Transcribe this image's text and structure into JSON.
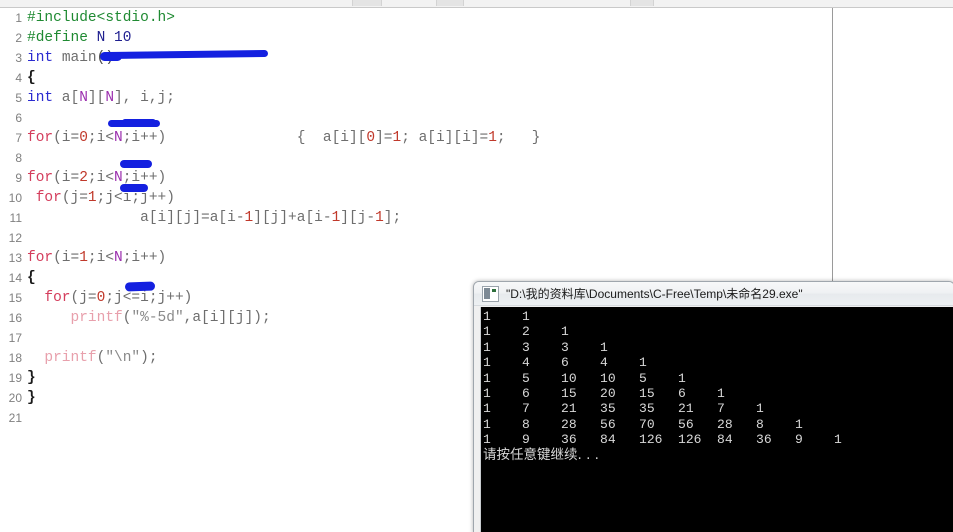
{
  "window": {
    "app_kind": "c-ide-editor"
  },
  "editor": {
    "name": "code-editor",
    "language": "c",
    "first_line_number": 1,
    "lines": [
      {
        "n": "1",
        "tokens": [
          {
            "t": "#include<stdio.h>",
            "c": "tok-pre"
          }
        ]
      },
      {
        "n": "2",
        "tokens": [
          {
            "t": "#define ",
            "c": "tok-pre"
          },
          {
            "t": "N",
            "c": "tok-macro-dark"
          },
          {
            "t": " 10",
            "c": "tok-macro-dark"
          }
        ]
      },
      {
        "n": "3",
        "tokens": [
          {
            "t": "int",
            "c": "tok-kw"
          },
          {
            "t": " ",
            "c": "tok-punc"
          },
          {
            "t": "main",
            "c": "tok-id"
          },
          {
            "t": "()",
            "c": "tok-punc"
          }
        ]
      },
      {
        "n": "4",
        "tokens": [
          {
            "t": "{",
            "c": "tok-brace"
          }
        ]
      },
      {
        "n": "5",
        "tokens": [
          {
            "t": "int",
            "c": "tok-kw"
          },
          {
            "t": " a[",
            "c": "tok-id"
          },
          {
            "t": "N",
            "c": "tok-macro"
          },
          {
            "t": "][",
            "c": "tok-id"
          },
          {
            "t": "N",
            "c": "tok-macro"
          },
          {
            "t": "], i,j;",
            "c": "tok-id"
          }
        ]
      },
      {
        "n": "6",
        "tokens": [
          {
            "t": "",
            "c": "tok-id"
          }
        ]
      },
      {
        "n": "7",
        "tokens": [
          {
            "t": "for",
            "c": "tok-kw2"
          },
          {
            "t": "(i=",
            "c": "tok-id"
          },
          {
            "t": "0",
            "c": "tok-num"
          },
          {
            "t": ";i<",
            "c": "tok-id"
          },
          {
            "t": "N",
            "c": "tok-macro"
          },
          {
            "t": ";i++)",
            "c": "tok-id"
          },
          {
            "t": "               {  a[i][",
            "c": "tok-id"
          },
          {
            "t": "0",
            "c": "tok-num"
          },
          {
            "t": "]=",
            "c": "tok-id"
          },
          {
            "t": "1",
            "c": "tok-num"
          },
          {
            "t": "; a[i][i]=",
            "c": "tok-id"
          },
          {
            "t": "1",
            "c": "tok-num"
          },
          {
            "t": ";   }",
            "c": "tok-id"
          }
        ]
      },
      {
        "n": "8",
        "tokens": [
          {
            "t": "",
            "c": "tok-id"
          }
        ]
      },
      {
        "n": "9",
        "tokens": [
          {
            "t": "for",
            "c": "tok-kw2"
          },
          {
            "t": "(i=",
            "c": "tok-id"
          },
          {
            "t": "2",
            "c": "tok-num"
          },
          {
            "t": ";i<",
            "c": "tok-id"
          },
          {
            "t": "N",
            "c": "tok-macro"
          },
          {
            "t": ";i++)",
            "c": "tok-id"
          }
        ]
      },
      {
        "n": "10",
        "tokens": [
          {
            "t": " ",
            "c": "tok-id"
          },
          {
            "t": "for",
            "c": "tok-kw2"
          },
          {
            "t": "(j=",
            "c": "tok-id"
          },
          {
            "t": "1",
            "c": "tok-num"
          },
          {
            "t": ";j<i;j++)",
            "c": "tok-id"
          }
        ]
      },
      {
        "n": "11",
        "tokens": [
          {
            "t": "             a[i][j]=a[i-",
            "c": "tok-id"
          },
          {
            "t": "1",
            "c": "tok-num"
          },
          {
            "t": "][j]+a[i-",
            "c": "tok-id"
          },
          {
            "t": "1",
            "c": "tok-num"
          },
          {
            "t": "][j-",
            "c": "tok-id"
          },
          {
            "t": "1",
            "c": "tok-num"
          },
          {
            "t": "];",
            "c": "tok-id"
          }
        ]
      },
      {
        "n": "12",
        "tokens": [
          {
            "t": "",
            "c": "tok-id"
          }
        ]
      },
      {
        "n": "13",
        "tokens": [
          {
            "t": "for",
            "c": "tok-kw2"
          },
          {
            "t": "(i=",
            "c": "tok-id"
          },
          {
            "t": "1",
            "c": "tok-num"
          },
          {
            "t": ";i<",
            "c": "tok-id"
          },
          {
            "t": "N",
            "c": "tok-macro"
          },
          {
            "t": ";i++)",
            "c": "tok-id"
          }
        ]
      },
      {
        "n": "14",
        "tokens": [
          {
            "t": "{",
            "c": "tok-brace"
          }
        ]
      },
      {
        "n": "15",
        "tokens": [
          {
            "t": "  ",
            "c": "tok-id"
          },
          {
            "t": "for",
            "c": "tok-kw2"
          },
          {
            "t": "(j=",
            "c": "tok-id"
          },
          {
            "t": "0",
            "c": "tok-num"
          },
          {
            "t": ";j<=i;j++)",
            "c": "tok-id"
          }
        ]
      },
      {
        "n": "16",
        "tokens": [
          {
            "t": "     ",
            "c": "tok-id"
          },
          {
            "t": "printf",
            "c": "tok-fn"
          },
          {
            "t": "(",
            "c": "tok-id"
          },
          {
            "t": "\"%-5d\"",
            "c": "tok-str"
          },
          {
            "t": ",a[i][j]);",
            "c": "tok-id"
          }
        ]
      },
      {
        "n": "17",
        "tokens": [
          {
            "t": "",
            "c": "tok-id"
          }
        ]
      },
      {
        "n": "18",
        "tokens": [
          {
            "t": "  ",
            "c": "tok-id"
          },
          {
            "t": "printf",
            "c": "tok-fn"
          },
          {
            "t": "(",
            "c": "tok-id"
          },
          {
            "t": "\"\\n\"",
            "c": "tok-str"
          },
          {
            "t": ");",
            "c": "tok-id"
          }
        ]
      },
      {
        "n": "19",
        "tokens": [
          {
            "t": "}",
            "c": "tok-brace"
          }
        ]
      },
      {
        "n": "20",
        "tokens": [
          {
            "t": "}",
            "c": "tok-brace"
          }
        ]
      },
      {
        "n": "21",
        "tokens": [
          {
            "t": "",
            "c": "tok-id"
          }
        ]
      }
    ]
  },
  "annotations": {
    "color": "#1420e0",
    "kind": "hand-drawn-blue-underline",
    "count": 5
  },
  "console": {
    "title": "\"D:\\我的资料库\\Documents\\C-Free\\Temp\\未命名29.exe\"",
    "icon": "console-app-icon",
    "background": "#000000",
    "foreground": "#d8d8d8",
    "output_lines": [
      "1    1",
      "1    2    1",
      "1    3    3    1",
      "1    4    6    4    1",
      "1    5    10   10   5    1",
      "1    6    15   20   15   6    1",
      "1    7    21   35   35   21   7    1",
      "1    8    28   56   70   56   28   8    1",
      "1    9    36   84   126  126  84   36   9    1"
    ],
    "prompt_line": "请按任意键继续. . .",
    "pascal_triangle_rows": [
      [
        1,
        1
      ],
      [
        1,
        2,
        1
      ],
      [
        1,
        3,
        3,
        1
      ],
      [
        1,
        4,
        6,
        4,
        1
      ],
      [
        1,
        5,
        10,
        10,
        5,
        1
      ],
      [
        1,
        6,
        15,
        20,
        15,
        6,
        1
      ],
      [
        1,
        7,
        21,
        35,
        35,
        21,
        7,
        1
      ],
      [
        1,
        8,
        28,
        56,
        70,
        56,
        28,
        8,
        1
      ],
      [
        1,
        9,
        36,
        84,
        126,
        126,
        84,
        36,
        9,
        1
      ]
    ]
  }
}
